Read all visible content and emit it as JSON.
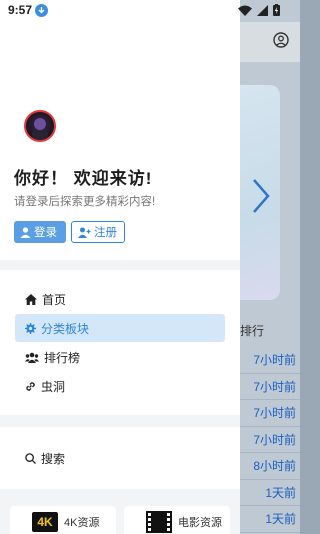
{
  "status_bar": {
    "time": "9:57"
  },
  "drawer": {
    "greeting": "你好！ 欢迎来访!",
    "subtitle": "请登录后探索更多精彩内容!",
    "login_label": "登录",
    "register_label": "注册",
    "menu": [
      {
        "label": "首页",
        "icon": "home-icon"
      },
      {
        "label": "分类板块",
        "icon": "gear-icon",
        "active": true
      },
      {
        "label": "排行榜",
        "icon": "users-icon"
      },
      {
        "label": "虫洞",
        "icon": "link-icon"
      }
    ],
    "search_label": "搜索",
    "quick_links": [
      {
        "label": "4K资源",
        "badge": "4K"
      },
      {
        "label": "电影资源"
      }
    ]
  },
  "background": {
    "rank_label": "排行",
    "list_times": [
      "7小时前",
      "7小时前",
      "7小时前",
      "7小时前",
      "8小时前",
      "1天前",
      "1天前"
    ]
  },
  "colors": {
    "accent": "#2f86de",
    "active_bg": "#d3e7f8",
    "login_bg": "#5a9fe5"
  }
}
